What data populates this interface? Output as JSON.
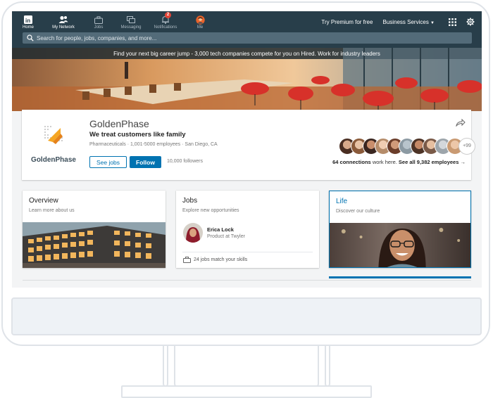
{
  "nav": {
    "items": [
      {
        "label": "Home",
        "icon": "linkedin-logo-icon",
        "active": true
      },
      {
        "label": "My Network",
        "icon": "network-icon",
        "active": true
      },
      {
        "label": "Jobs",
        "icon": "briefcase-icon"
      },
      {
        "label": "Messaging",
        "icon": "messaging-icon"
      },
      {
        "label": "Notifications",
        "icon": "bell-icon",
        "badge": "2"
      },
      {
        "label": "Me",
        "icon": "avatar-icon"
      }
    ],
    "premium": "Try Premium for free",
    "business": "Business Services"
  },
  "search": {
    "placeholder": "Search for people, jobs, companies, and more..."
  },
  "banner": {
    "text": "Find your next big career jump - 3,000 tech companies compete for you on Hired. Work for industry leaders"
  },
  "company": {
    "name": "GoldenPhase",
    "logo_text": "GoldenPhase",
    "tagline": "We treat customers like family",
    "meta": "Pharmaceuticals · 1,001-5000 employees · San Diego, CA",
    "see_jobs": "See jobs",
    "follow": "Follow",
    "followers": "10,000 followers",
    "more_avatars": "+99",
    "connections_bold": "64 connections",
    "connections_rest": " work here. ",
    "see_all": "See all 9,382 employees"
  },
  "cards": {
    "overview": {
      "title": "Overview",
      "subtitle": "Learn more about us"
    },
    "jobs": {
      "title": "Jobs",
      "subtitle": "Explore new opportunities",
      "person_name": "Erica Lock",
      "person_role": "Product at Twyler",
      "match": "24 jobs match your skills"
    },
    "life": {
      "title": "Life",
      "subtitle": "Discover our culture"
    }
  },
  "colors": {
    "nav_bg": "#283e4a",
    "accent": "#0073b1",
    "logo_orange": "#f5a623"
  }
}
